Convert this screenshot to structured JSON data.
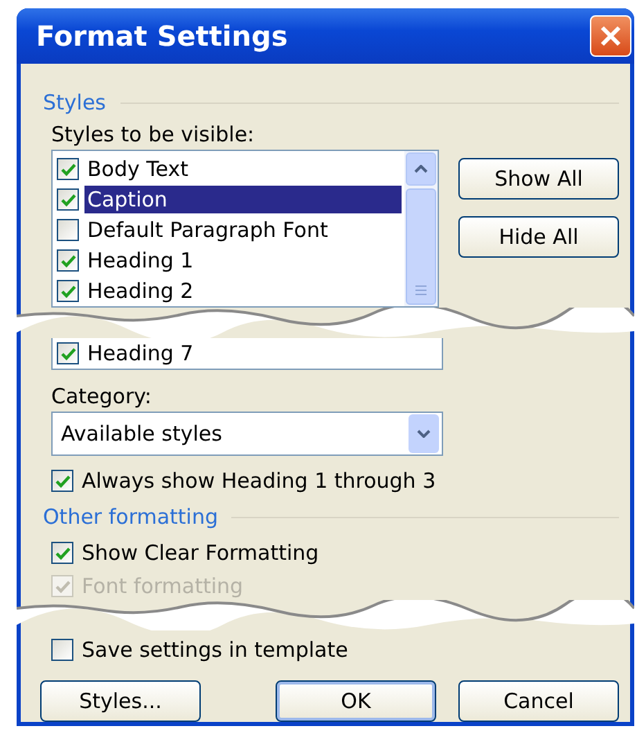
{
  "window": {
    "title": "Format Settings"
  },
  "styles_section": {
    "heading": "Styles",
    "list_label": "Styles to be visible:",
    "items": [
      {
        "label": "Body Text",
        "checked": true,
        "selected": false
      },
      {
        "label": "Caption",
        "checked": true,
        "selected": true
      },
      {
        "label": "Default Paragraph Font",
        "checked": false,
        "selected": false
      },
      {
        "label": "Heading 1",
        "checked": true,
        "selected": false
      },
      {
        "label": "Heading 2",
        "checked": true,
        "selected": false
      }
    ],
    "items_after_tear": [
      {
        "label": "Heading 7",
        "checked": true,
        "selected": false
      }
    ],
    "side_buttons": [
      "Show All",
      "Hide All"
    ],
    "category_label": "Category:",
    "category_value": "Available styles",
    "always_show": {
      "label": "Always show Heading 1 through 3",
      "checked": true
    }
  },
  "other_section": {
    "heading": "Other formatting",
    "options": [
      {
        "label": "Show Clear Formatting",
        "checked": true,
        "disabled": false
      },
      {
        "label": "Font formatting",
        "checked": true,
        "disabled": true
      }
    ]
  },
  "save_in_template": {
    "label": "Save settings in template",
    "checked": false
  },
  "buttons": [
    {
      "label": "Styles...",
      "default": false
    },
    {
      "label": "OK",
      "default": true
    },
    {
      "label": "Cancel",
      "default": false
    }
  ]
}
